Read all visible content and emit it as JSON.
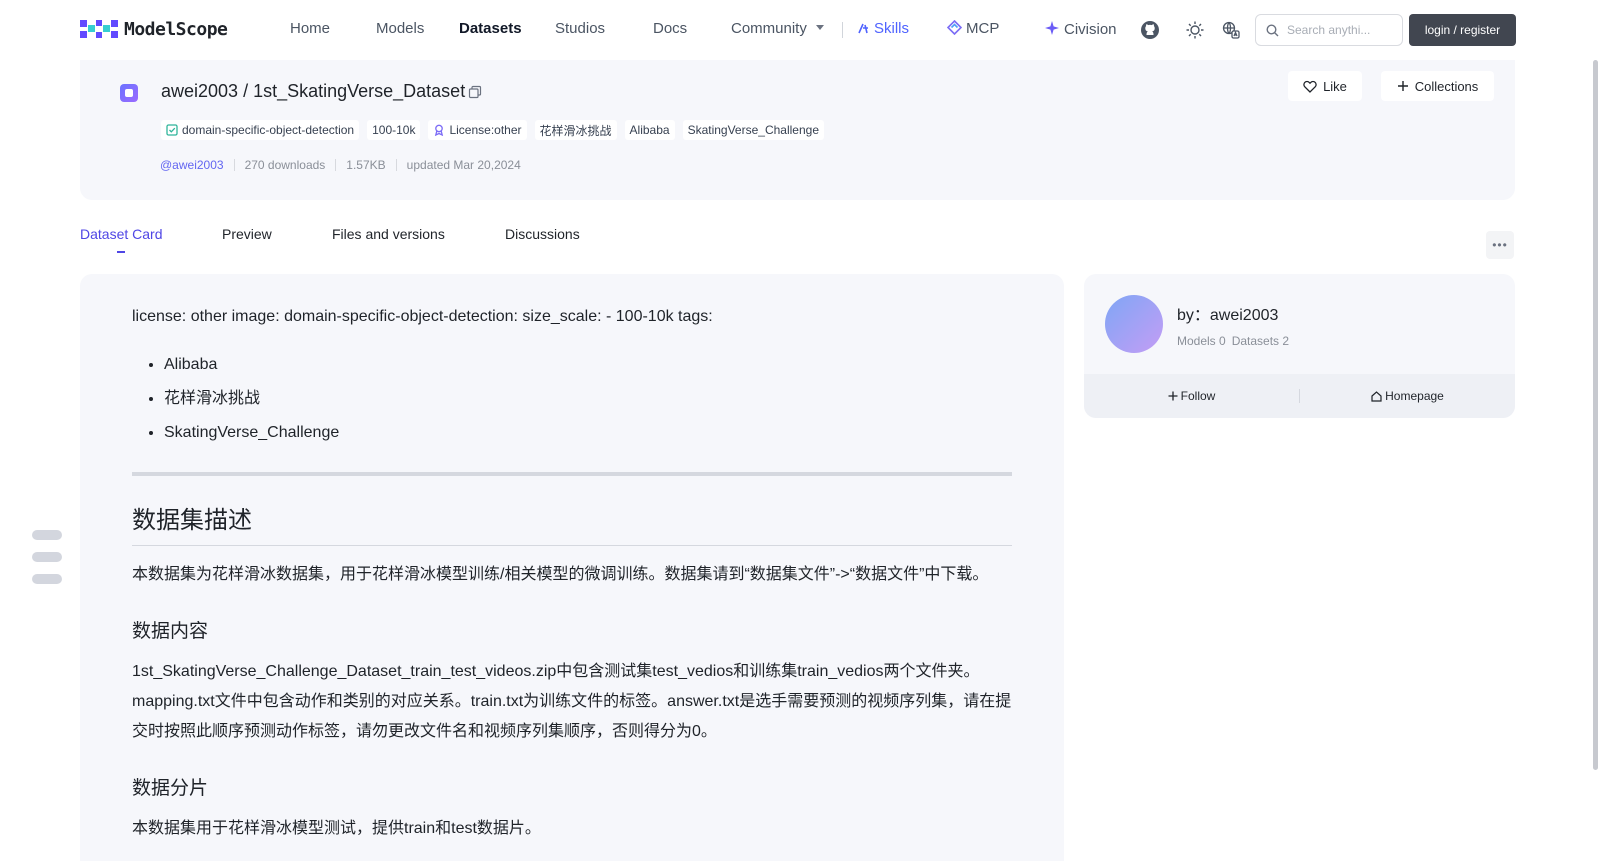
{
  "nav": {
    "logo_text": "ModelScope",
    "items": [
      "Home",
      "Models",
      "Datasets",
      "Studios",
      "Docs"
    ],
    "community_label": "Community",
    "skills_label": "Skills",
    "mcp_label": "MCP",
    "civision_label": "Civision",
    "search_placeholder": "Search anythi...",
    "login_label": "login / register",
    "colors": {
      "skills": "#4f63ff",
      "login_bg": "#414650"
    }
  },
  "dataset": {
    "title": "awei2003 / 1st_SkatingVerse_Dataset",
    "tags": [
      "domain-specific-object-detection",
      "100-10k",
      "License:other",
      "花样滑冰挑战",
      "Alibaba",
      "SkatingVerse_Challenge"
    ],
    "author": "@awei2003",
    "downloads": "270 downloads",
    "size": "1.57KB",
    "updated": "updated Mar 20,2024",
    "like_label": "Like",
    "collections_label": "Collections"
  },
  "tabs": [
    "Dataset Card",
    "Preview",
    "Files and versions",
    "Discussions"
  ],
  "active_tab": "Dataset Card",
  "content": {
    "front_matter": "license: other image: domain-specific-object-detection: size_scale: - 100-10k tags:",
    "tag_list": [
      "Alibaba",
      "花样滑冰挑战",
      "SkatingVerse_Challenge"
    ],
    "h_desc": "数据集描述",
    "p_desc": "本数据集为花样滑冰数据集，用于花样滑冰模型训练/相关模型的微调训练。数据集请到“数据集文件”->“数据文件”中下载。",
    "h_content": "数据内容",
    "p_content": "1st_SkatingVerse_Challenge_Dataset_train_test_videos.zip中包含测试集test_vedios和训练集train_vedios两个文件夹。mapping.txt文件中包含动作和类别的对应关系。train.txt为训练文件的标签。answer.txt是选手需要预测的视频序列集，请在提交时按照此顺序预测动作标签，请勿更改文件名和视频序列集顺序，否则得分为0。",
    "h_split": "数据分片",
    "p_split": "本数据集用于花样滑冰模型测试，提供train和test数据片。"
  },
  "owner": {
    "by": "by：awei2003",
    "models": "Models 0",
    "datasets": "Datasets 2",
    "follow_label": "Follow",
    "homepage_label": "Homepage"
  }
}
